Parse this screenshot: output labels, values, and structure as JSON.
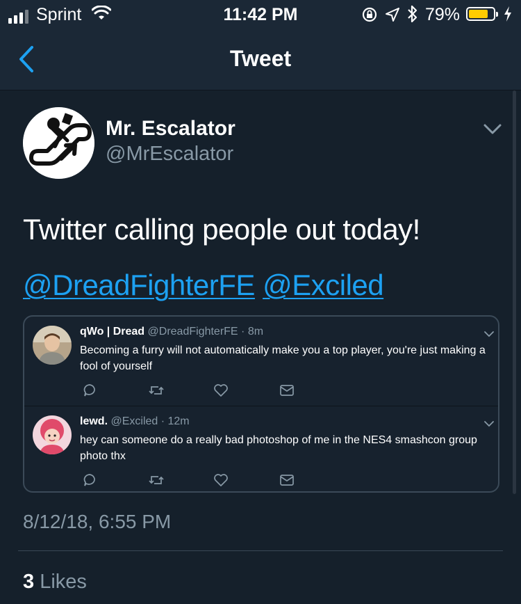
{
  "status_bar": {
    "carrier": "Sprint",
    "time": "11:42 PM",
    "battery_percent": "79%",
    "battery_level": 0.79,
    "icons": [
      "signal-icon",
      "wifi-icon",
      "rotation-lock-icon",
      "location-icon",
      "bluetooth-icon",
      "battery-icon",
      "charging-icon"
    ]
  },
  "header": {
    "title": "Tweet",
    "back_icon": "chevron-left-icon"
  },
  "tweet": {
    "author_name": "Mr. Escalator",
    "author_handle": "@MrEscalator",
    "text": "Twitter calling people out today!",
    "mentions": [
      "@DreadFighterFE",
      "@Exciled"
    ],
    "timestamp": "8/12/18, 6:55 PM",
    "likes_count": "3",
    "likes_label": "Likes"
  },
  "embedded_tweets": [
    {
      "name": "qWo | Dread",
      "meta": "@DreadFighterFE · 8m",
      "text": "Becoming a furry will not automatically make you a top player, you're just making a fool of yourself"
    },
    {
      "name": "lewd.",
      "meta": "@Exciled · 12m",
      "text": "hey can someone do a really bad photoshop of me in the NES4 smashcon group photo thx"
    }
  ],
  "colors": {
    "background": "#15202b",
    "header": "#1b2836",
    "accent": "#1da1f2",
    "secondary_text": "#8899a6",
    "battery": "#ffcc00"
  }
}
